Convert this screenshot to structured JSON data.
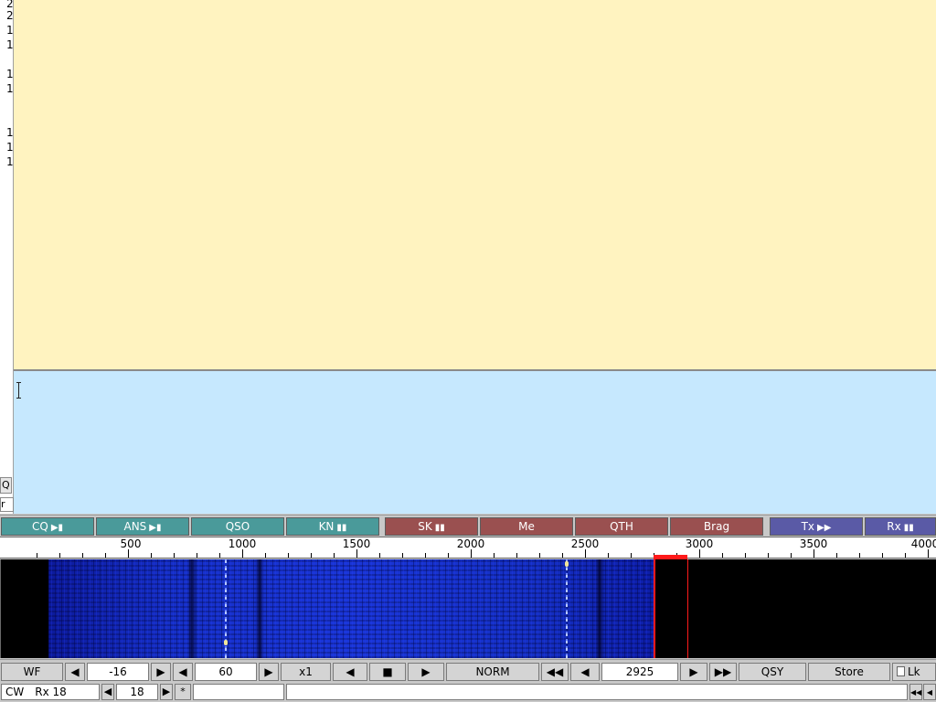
{
  "left_strip": {
    "digits": [
      "2",
      "2",
      "1",
      "1",
      "1",
      "1",
      "1",
      "1",
      "1"
    ],
    "q_label": "Q",
    "r_label": "r"
  },
  "macros": [
    {
      "label": "CQ",
      "glyph": "▶▮",
      "color": "#4a9a9a"
    },
    {
      "label": "ANS",
      "glyph": "▶▮",
      "color": "#4a9a9a"
    },
    {
      "label": "QSO",
      "glyph": "",
      "color": "#4a9a9a"
    },
    {
      "label": "KN",
      "glyph": "▮▮",
      "color": "#4a9a9a"
    },
    {
      "label": "SK",
      "glyph": "▮▮",
      "color": "#9a5050"
    },
    {
      "label": "Me",
      "glyph": "",
      "color": "#9a5050"
    },
    {
      "label": "QTH",
      "glyph": "",
      "color": "#9a5050"
    },
    {
      "label": "Brag",
      "glyph": "",
      "color": "#9a5050"
    },
    {
      "label": "Tx",
      "glyph": "▶▶",
      "color": "#5a5aa6"
    },
    {
      "label": "Rx",
      "glyph": "▮▮",
      "color": "#5a5aa6"
    }
  ],
  "scale": {
    "labels": [
      "500",
      "1000",
      "1500",
      "2000",
      "2500",
      "3000",
      "3500",
      "4000"
    ]
  },
  "waterfall": {
    "cursor_frequency": 2925
  },
  "toolbar": {
    "wf_label": "WF",
    "left_arrow": "◀",
    "right_arrow": "▶",
    "ref_level": "-16",
    "range": "60",
    "zoom": "x1",
    "stop_glyph": "■",
    "mode": "NORM",
    "fast_back": "◀◀",
    "fast_fwd": "▶▶",
    "frequency": "2925",
    "qsy": "QSY",
    "store": "Store",
    "lock": "Lk"
  },
  "statusbar": {
    "mode": "CW",
    "rx_label": "Rx 18",
    "value": "18",
    "star": "*",
    "skip_back": "◀◀",
    "back": "◀"
  },
  "colors": {
    "rx_pane": "#fff3c0",
    "tx_pane": "#c6e8fe",
    "cursor": "#ff1a1a"
  }
}
